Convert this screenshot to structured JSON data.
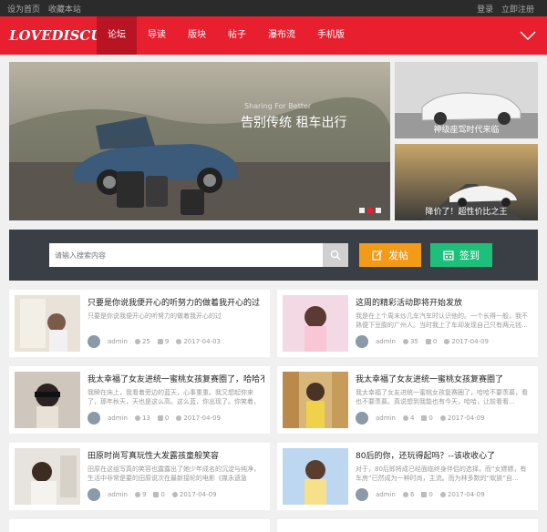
{
  "topbar": {
    "left": [
      "设为首页",
      "收藏本站"
    ],
    "right": [
      "登录",
      "立即注册"
    ]
  },
  "nav": {
    "logo": "LOVEDISCUZ",
    "items": [
      "论坛",
      "导读",
      "版块",
      "帖子",
      "瀑布流",
      "手机版"
    ],
    "active_index": 0,
    "menu_icon": "chevron-down-icon"
  },
  "banner": {
    "main": {
      "small_text": "Sharing For Better",
      "big_text": "告别传统 租车出行"
    },
    "side": [
      {
        "caption": "神级座驾时代来临"
      },
      {
        "caption": "降价了！超性价比之王"
      }
    ],
    "dots_count": 3,
    "active_dot": 2
  },
  "search": {
    "placeholder": "请输入搜索内容",
    "post_label": "发帖",
    "sign_label": "签到",
    "bg_text": "DISCUZ"
  },
  "posts": [
    {
      "title": "只要是你说我便开心的听努力的做着我开心的过",
      "desc": "只要是你说我便开心的听努力的做着我开心的过",
      "author": "admin",
      "views": "25",
      "replies": "9",
      "date": "2017-04-03"
    },
    {
      "title": "这周的精彩活动即将开始发放",
      "desc": "我是在上个周末炒几车汽车时认识他的。一个长得一般，我不熟便下豆膨的广州人。当时我上了车却发现自己只有两元钱...",
      "author": "admin",
      "views": "35",
      "replies": "0",
      "date": "2017-04-09"
    },
    {
      "title": "我太幸福了女友进统一蜜桃女孩复赛圈了，哈哈不要羡慕",
      "desc": "我瞬在床上，我看着旁边的蓝天，心事重重。我又想起你来了，那年秋天，天也是这么高。这么蓝，你出现了。你笑着，笑得...",
      "author": "admin",
      "views": "13",
      "replies": "0",
      "date": "2017-04-09"
    },
    {
      "title": "我太幸福了女友进统一蜜桃女孩复赛圈了",
      "desc": "我太幸福了女友进统一蜜桃女孩复赛圈了，哈哈不要羡慕，看也不要羡慕。真说想到我能也有今天，哈哈，让前看看...",
      "author": "admin",
      "views": "4",
      "replies": "0",
      "date": "2017-04-09"
    },
    {
      "title": "田原时尚写真玩性大发露孩童般笑容",
      "desc": "田原在这组写真的笑容也露露出了她少年成名的沉淀与纯净，生活中非常是要的田原说次在最新接轮的电影《媒永遗急报》...",
      "author": "admin",
      "views": "9",
      "replies": "0",
      "date": "2017-04-09"
    },
    {
      "title": "80后的你，还玩得起吗？--该收收心了",
      "desc": "对于，80后即将成已经面临终身伴侣的选择，而“女嫖嫖，有车房”已然成为一种时尚，主流。而为林多数的“蚁族”自...",
      "author": "admin",
      "views": "6",
      "replies": "0",
      "date": "2017-04-09"
    }
  ],
  "colors": {
    "brand_red": "#e71f2f",
    "post_orange": "#f39a17",
    "sign_green": "#1ebf7a"
  }
}
